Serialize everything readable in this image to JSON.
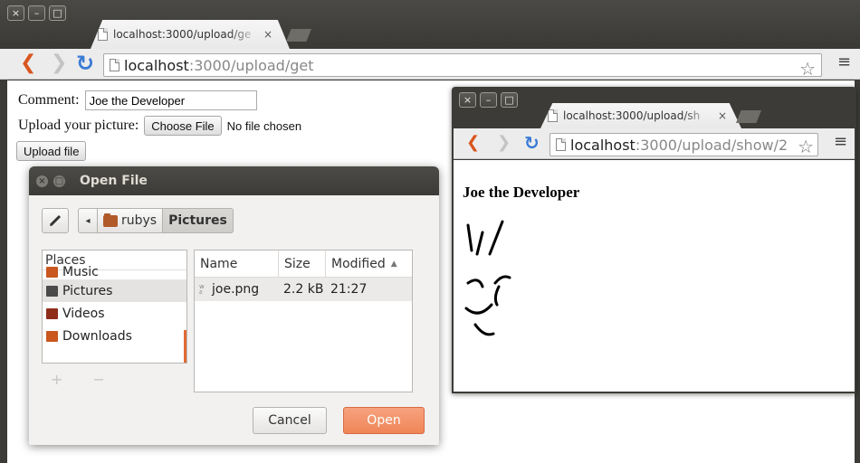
{
  "main_window": {
    "tab_title": "localhost:3000/upload/ge",
    "tab_close": "×",
    "url_host": "localhost",
    "url_rest": ":3000/upload/get",
    "form": {
      "comment_label": "Comment:",
      "comment_value": "Joe the Developer",
      "upload_label": "Upload your picture:",
      "choose_file_label": "Choose File",
      "no_file_text": "No file chosen",
      "submit_label": "Upload file"
    }
  },
  "open_file_dialog": {
    "title": "Open File",
    "path": [
      "rubys",
      "Pictures"
    ],
    "places_header": "Places",
    "places": [
      {
        "label": "Music",
        "icon": "music-folder-icon",
        "color": "#c9571f"
      },
      {
        "label": "Pictures",
        "icon": "pictures-folder-icon",
        "color": "#4a4a4a",
        "selected": true
      },
      {
        "label": "Videos",
        "icon": "videos-folder-icon",
        "color": "#8e2d1a"
      },
      {
        "label": "Downloads",
        "icon": "downloads-folder-icon",
        "color": "#c9571f"
      }
    ],
    "columns": {
      "name": "Name",
      "size": "Size",
      "modified": "Modified"
    },
    "sort_indicator": "▲",
    "files": [
      {
        "name": "joe.png",
        "size": "2.2 kB",
        "modified": "21:27"
      }
    ],
    "add_remove": "+ −",
    "cancel_label": "Cancel",
    "open_label": "Open"
  },
  "second_window": {
    "tab_title": "localhost:3000/upload/sh",
    "tab_close": "×",
    "url_host": "localhost",
    "url_rest": ":3000/upload/show/2",
    "heading": "Joe the Developer"
  },
  "icons": {
    "back": "❮",
    "forward": "❯",
    "reload": "↻",
    "star": "☆",
    "menu": "≡",
    "close": "×",
    "minimize": "–",
    "maximize": "□"
  },
  "colors": {
    "accent": "#ef8658",
    "back_button": "#d9561f",
    "reload_button": "#3a7bd5"
  }
}
